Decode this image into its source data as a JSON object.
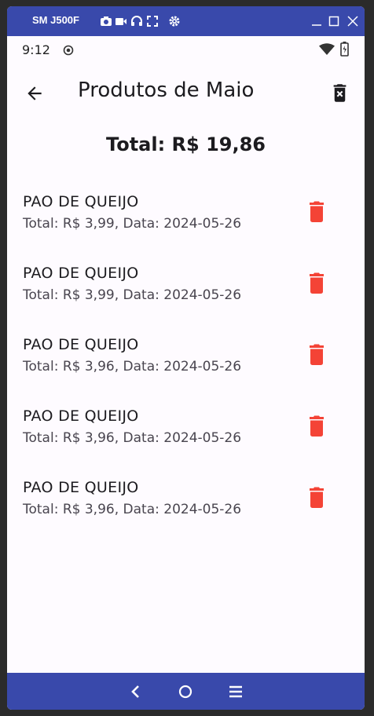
{
  "emulator": {
    "device_name": "SM J500F",
    "toolbar_icons": [
      "camera-icon",
      "video-icon",
      "headphones-icon",
      "fullscreen-icon",
      "settings-icon"
    ],
    "window_controls": [
      "minimize-icon",
      "maximize-icon",
      "close-icon"
    ]
  },
  "status_bar": {
    "time": "9:12",
    "icons": [
      "record-icon",
      "wifi-icon",
      "battery-icon"
    ]
  },
  "app_bar": {
    "title": "Produtos de Maio",
    "back_icon": "arrow-back-icon",
    "action_icon": "delete-forever-icon"
  },
  "total_label": "Total: R$ 19,86",
  "items": [
    {
      "name": "PAO DE QUEIJO",
      "details": "Total: R$ 3,99, Data: 2024-05-26"
    },
    {
      "name": "PAO DE QUEIJO",
      "details": "Total: R$ 3,99, Data: 2024-05-26"
    },
    {
      "name": "PAO DE QUEIJO",
      "details": "Total: R$ 3,96, Data: 2024-05-26"
    },
    {
      "name": "PAO DE QUEIJO",
      "details": "Total: R$ 3,96, Data: 2024-05-26"
    },
    {
      "name": "PAO DE QUEIJO",
      "details": "Total: R$ 3,96, Data: 2024-05-26"
    }
  ],
  "colors": {
    "emulator_bar": "#3949ab",
    "delete_red": "#f44336",
    "background": "#fefbff"
  },
  "nav_bar": [
    "back-nav-icon",
    "home-nav-icon",
    "menu-nav-icon"
  ]
}
